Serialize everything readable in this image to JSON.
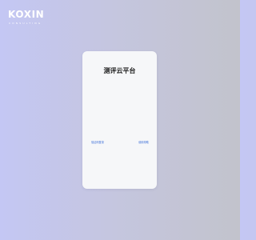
{
  "brand": {
    "name": "KOXIN",
    "tagline": "CONSULTING"
  },
  "login_card": {
    "title": "测评云平台",
    "left_link": "验证码登录",
    "right_link": "使用帮助"
  },
  "colors": {
    "background_start": "#c4c7f4",
    "background_end": "#c2c3cc",
    "card": "#f6f7f9",
    "link": "#3d6fd8"
  }
}
